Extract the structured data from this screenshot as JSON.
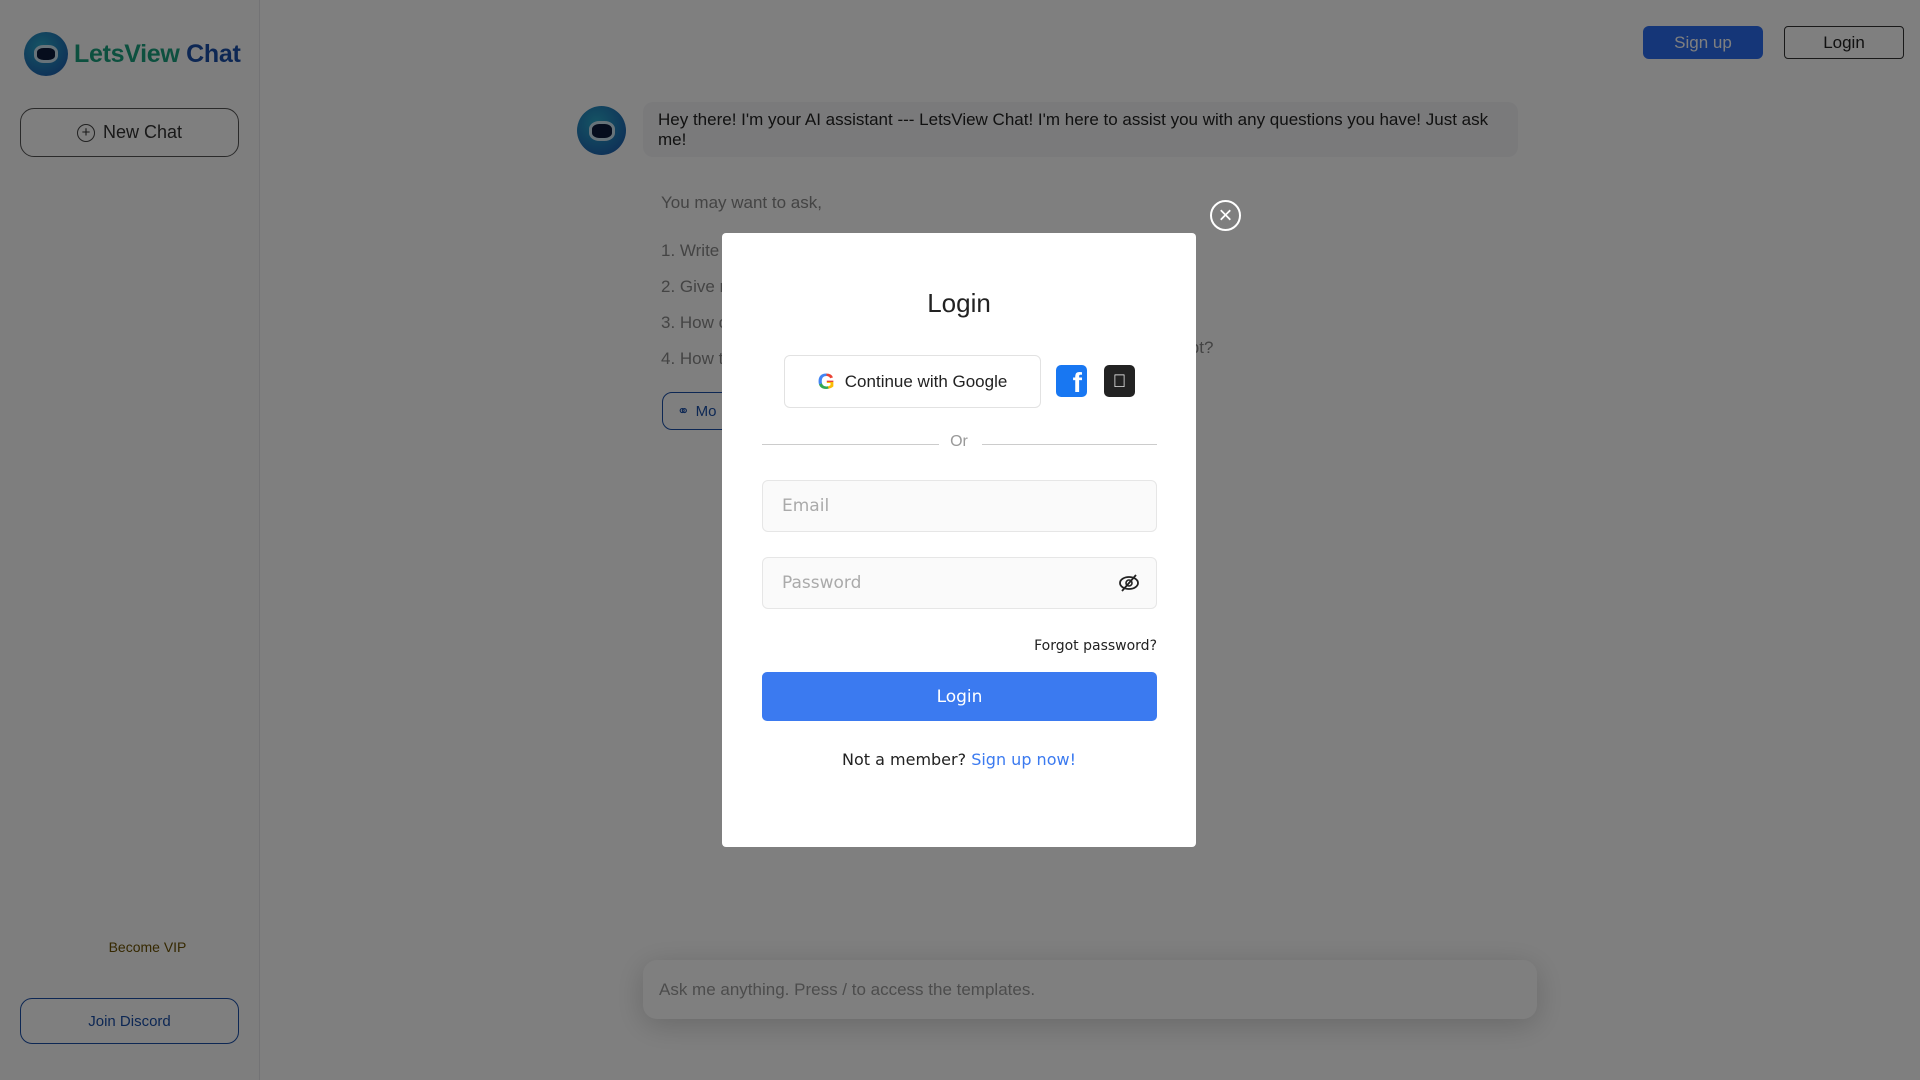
{
  "brand": {
    "name_part1": "LetsView",
    "name_part2": " Chat"
  },
  "sidebar": {
    "new_chat": "New Chat",
    "become_vip": "Become VIP",
    "join_discord": "Join Discord"
  },
  "header": {
    "sign_up": "Sign up",
    "login": "Login"
  },
  "chat": {
    "greeting": "Hey there! I'm your AI assistant --- LetsView Chat! I'm here to assist you with any questions you have! Just ask me!",
    "suggest_title": "You may want to ask,",
    "suggestions": [
      "1. Write",
      "2. Give r",
      "3. How c",
      "4. How t"
    ],
    "suggestion_4_tail": "ipt?",
    "more_label": "Mo",
    "input_placeholder": "Ask me anything. Press / to access the templates."
  },
  "modal": {
    "title": "Login",
    "google": "Continue with Google",
    "or": "Or",
    "email_placeholder": "Email",
    "password_placeholder": "Password",
    "forgot": "Forgot password?",
    "login": "Login",
    "not_member": "Not a member? ",
    "sign_up_now": "Sign up now!"
  },
  "colors": {
    "primary": "#3b7af0",
    "brand_blue": "#1a4fa8",
    "brand_green": "#1aa07e",
    "facebook": "#1877f2"
  }
}
